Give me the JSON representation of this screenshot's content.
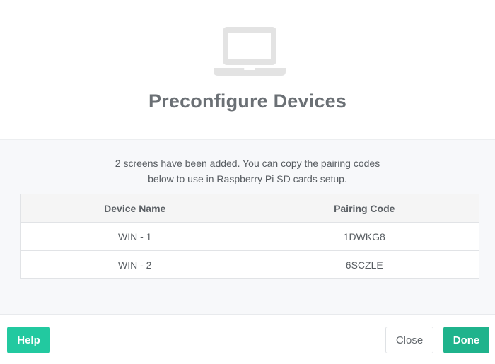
{
  "header": {
    "icon": "laptop-icon",
    "title": "Preconfigure Devices"
  },
  "description": {
    "line1": "2 screens have been added. You can copy the pairing codes",
    "line2": "below to use in Raspberry Pi SD cards setup."
  },
  "table": {
    "columns": [
      "Device Name",
      "Pairing Code"
    ],
    "rows": [
      [
        "WIN - 1",
        "1DWKG8"
      ],
      [
        "WIN - 2",
        "6SCZLE"
      ]
    ]
  },
  "footer": {
    "help_label": "Help",
    "close_label": "Close",
    "done_label": "Done"
  },
  "colors": {
    "help_button": "#22c9a0",
    "done_button": "#1fb38c",
    "icon_gray": "#e3e3e3"
  }
}
